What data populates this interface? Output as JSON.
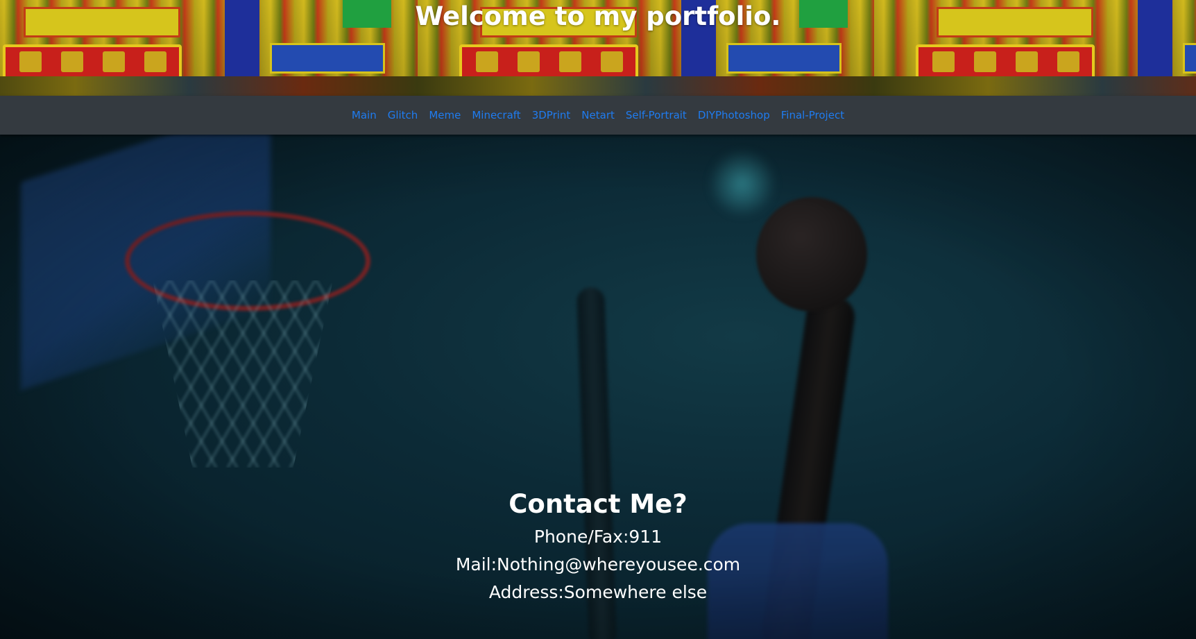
{
  "header": {
    "title": "Welcome to my portfolio."
  },
  "nav": {
    "items": [
      {
        "label": "Main"
      },
      {
        "label": "Glitch"
      },
      {
        "label": "Meme"
      },
      {
        "label": "Minecraft"
      },
      {
        "label": "3DPrint"
      },
      {
        "label": "Netart"
      },
      {
        "label": "Self-Portrait"
      },
      {
        "label": "DIYPhotoshop"
      },
      {
        "label": "Final-Project"
      }
    ]
  },
  "contact": {
    "heading": "Contact Me?",
    "phone": "Phone/Fax:911",
    "mail": "Mail:Nothing@whereyousee.com",
    "address": "Address:Somewhere else"
  },
  "colors": {
    "navbar_bg": "#343a40",
    "link": "#1f7cf0",
    "text": "#ffffff"
  }
}
